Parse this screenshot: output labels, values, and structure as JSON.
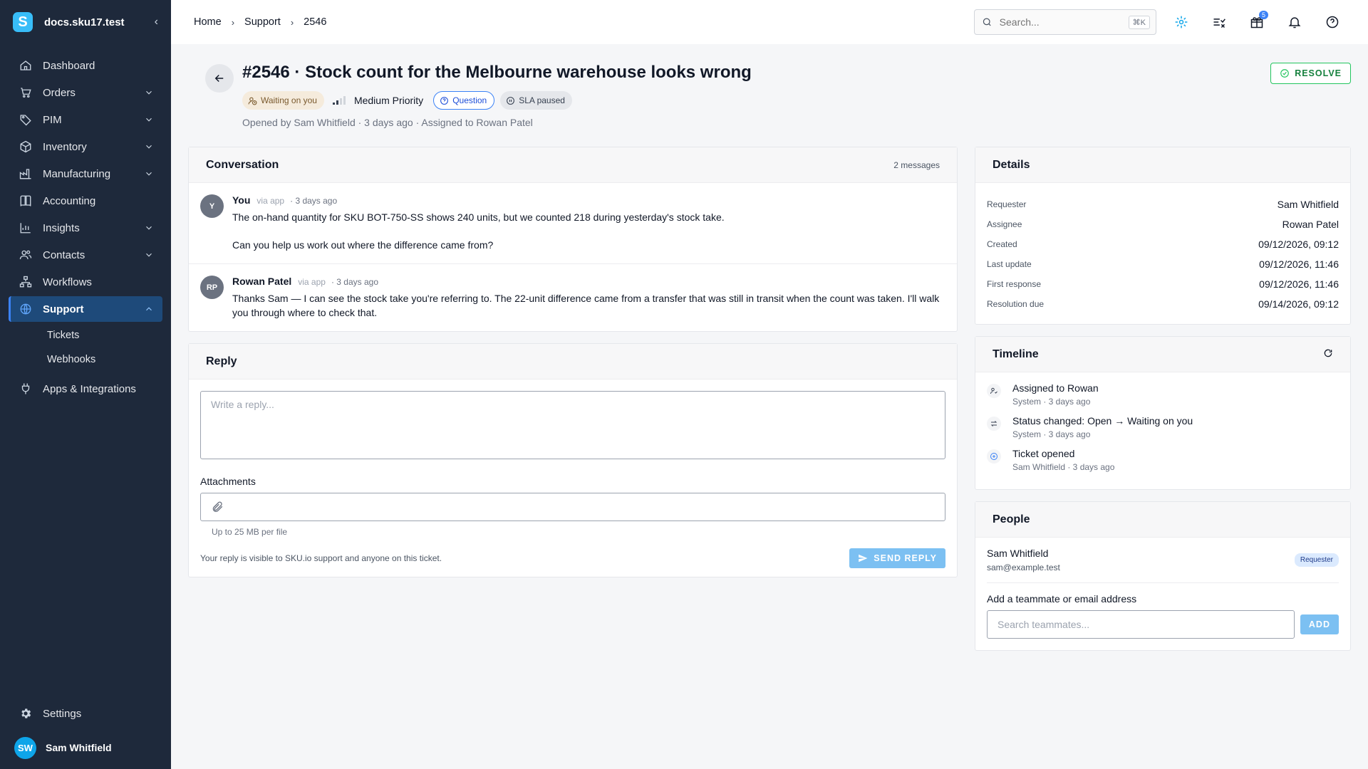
{
  "brand": {
    "logo_letter": "S",
    "name": "docs.sku17.test"
  },
  "nav": [
    {
      "label": "Dashboard",
      "icon": "home-icon",
      "has_children": false
    },
    {
      "label": "Orders",
      "icon": "cart-icon",
      "has_children": true
    },
    {
      "label": "PIM",
      "icon": "tag-icon",
      "has_children": true
    },
    {
      "label": "Inventory",
      "icon": "box-icon",
      "has_children": true
    },
    {
      "label": "Manufacturing",
      "icon": "factory-icon",
      "has_children": true
    },
    {
      "label": "Accounting",
      "icon": "book-icon",
      "has_children": false
    },
    {
      "label": "Insights",
      "icon": "chart-icon",
      "has_children": true
    },
    {
      "label": "Contacts",
      "icon": "contacts-icon",
      "has_children": true
    },
    {
      "label": "Workflows",
      "icon": "workflow-icon",
      "has_children": false
    },
    {
      "label": "Support",
      "icon": "globe-icon",
      "has_children": true,
      "active": true,
      "children": [
        "Tickets",
        "Webhooks"
      ]
    },
    {
      "label": "Apps & Integrations",
      "icon": "plug-icon",
      "has_children": false
    }
  ],
  "settings_label": "Settings",
  "user": {
    "initials": "SW",
    "name": "Sam Whitfield"
  },
  "breadcrumb": [
    "Home",
    "Support",
    "2546"
  ],
  "search": {
    "placeholder": "Search...",
    "shortcut": "⌘K"
  },
  "notifications_badge": "5",
  "ticket": {
    "title": "#2546 · Stock count for the Melbourne warehouse looks wrong",
    "status": "Waiting on you",
    "priority": "Medium Priority",
    "priority_level": 2,
    "priority_max": 4,
    "type": "Question",
    "sla": "SLA paused",
    "meta": "Opened by Sam Whitfield · 3 days ago · Assigned to Rowan Patel",
    "resolve_label": "RESOLVE"
  },
  "conversation": {
    "title": "Conversation",
    "count": "2 messages",
    "messages": [
      {
        "initials": "Y",
        "author": "You",
        "via": "via app",
        "time": "· 3 days ago",
        "paragraphs": [
          "The on-hand quantity for SKU BOT-750-SS shows 240 units, but we counted 218 during yesterday's stock take.",
          "Can you help us work out where the difference came from?"
        ]
      },
      {
        "initials": "RP",
        "author": "Rowan Patel",
        "via": "via app",
        "time": "· 3 days ago",
        "paragraphs": [
          "Thanks Sam — I can see the stock take you're referring to. The 22-unit difference came from a transfer that was still in transit when the count was taken. I'll walk you through where to check that."
        ]
      }
    ]
  },
  "reply": {
    "title": "Reply",
    "placeholder": "Write a reply...",
    "attachments_label": "Attachments",
    "attachments_hint": "Up to 25 MB per file",
    "note": "Your reply is visible to SKU.io support and anyone on this ticket.",
    "send_label": "SEND REPLY"
  },
  "details": {
    "title": "Details",
    "rows": [
      {
        "key": "Requester",
        "value": "Sam Whitfield"
      },
      {
        "key": "Assignee",
        "value": "Rowan Patel"
      },
      {
        "key": "Created",
        "value": "09/12/2026, 09:12"
      },
      {
        "key": "Last update",
        "value": "09/12/2026, 11:46"
      },
      {
        "key": "First response",
        "value": "09/12/2026, 11:46"
      },
      {
        "key": "Resolution due",
        "value": "09/14/2026, 09:12"
      }
    ]
  },
  "timeline": {
    "title": "Timeline",
    "items": [
      {
        "icon": "assign-icon",
        "title": "Assigned to Rowan",
        "sub": "System · 3 days ago"
      },
      {
        "icon": "swap-icon",
        "title": "Status changed: Open → Waiting on you",
        "sub": "System · 3 days ago"
      },
      {
        "icon": "plus-circle-icon",
        "title": "Ticket opened",
        "sub": "Sam Whitfield · 3 days ago"
      }
    ]
  },
  "people": {
    "title": "People",
    "person": {
      "name": "Sam Whitfield",
      "email": "sam@example.test",
      "role": "Requester"
    },
    "add_label": "Add a teammate or email address",
    "add_placeholder": "Search teammates...",
    "add_button": "ADD"
  },
  "colors": {
    "sidebar": "#1e293b",
    "accent": "#3b82f6",
    "resolve": "#22c55e"
  }
}
